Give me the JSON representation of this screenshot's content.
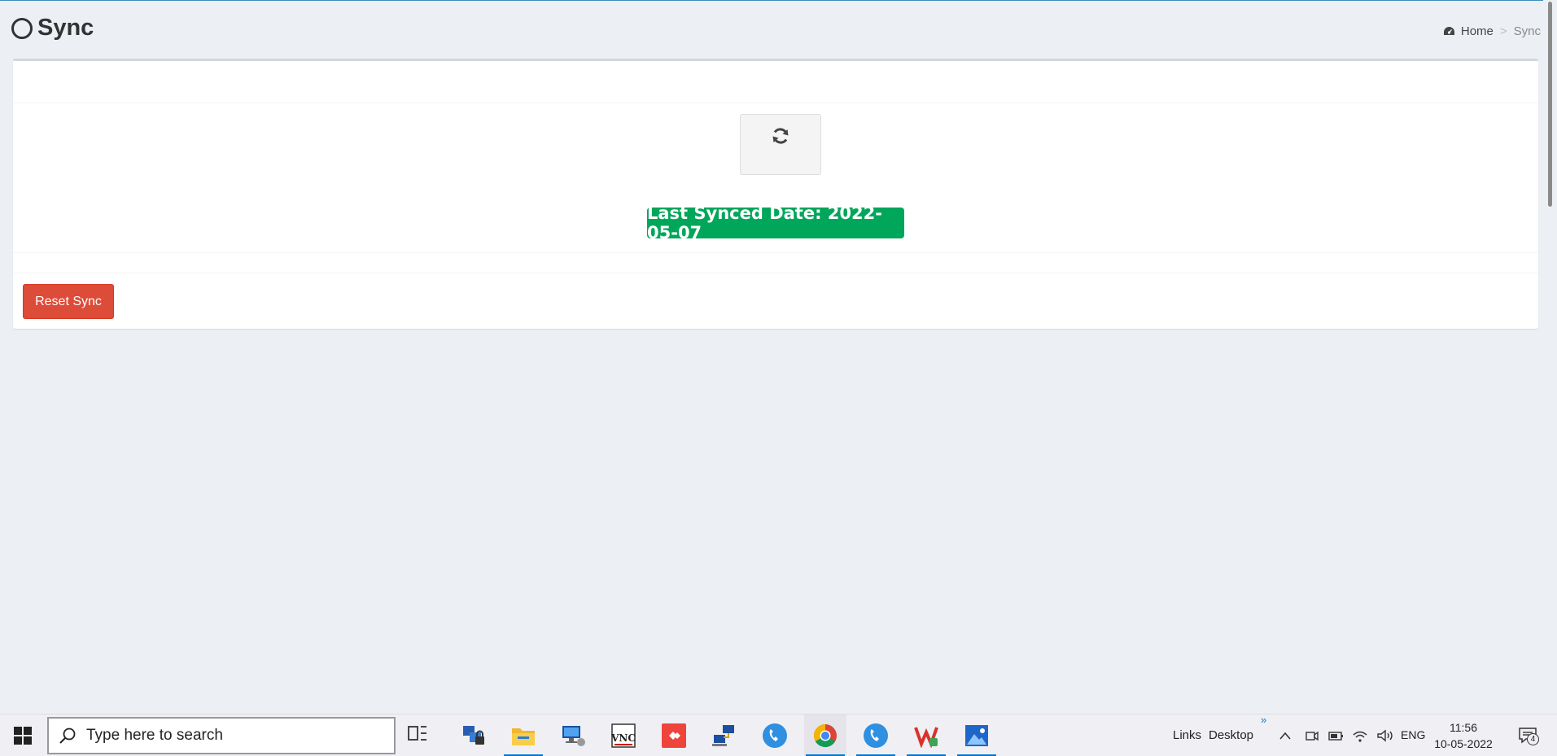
{
  "header": {
    "title": "Sync",
    "breadcrumb": {
      "home": "Home",
      "separator": ">",
      "current": "Sync"
    }
  },
  "main": {
    "status_label": "Last Synced Date: 2022-05-07",
    "reset_button": "Reset Sync"
  },
  "taskbar": {
    "search_placeholder": "Type here to search",
    "links": "Links",
    "desktop": "Desktop",
    "language": "ENG",
    "time": "11:56",
    "date": "10-05-2022",
    "notifications": "4"
  },
  "colors": {
    "success": "#00a65a",
    "danger": "#dd4b39",
    "accent": "#0078d4"
  }
}
